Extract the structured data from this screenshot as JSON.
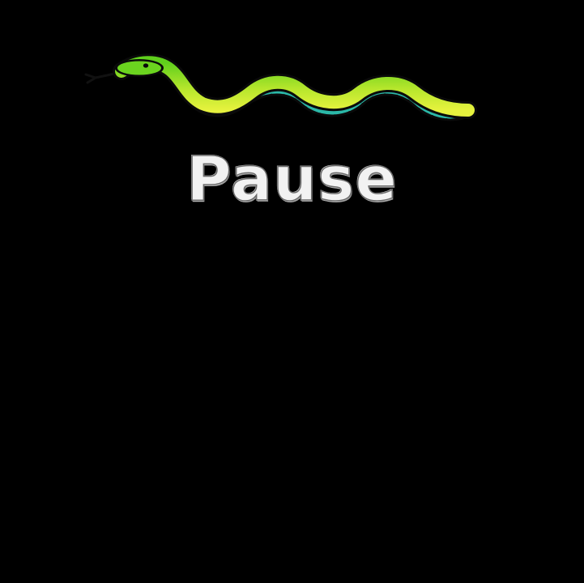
{
  "screen": {
    "title": "Pause"
  },
  "logo": {
    "icon": "snake-icon",
    "colors": {
      "body_light": "#d4f03a",
      "body_green": "#5fcf1c",
      "belly": "#2bb8a8",
      "outline": "#0a0a0a",
      "tongue": "#111111"
    }
  },
  "colors": {
    "background": "#000000",
    "title_fill": "#f2f2f2",
    "title_outline": "#6a6a6a"
  }
}
